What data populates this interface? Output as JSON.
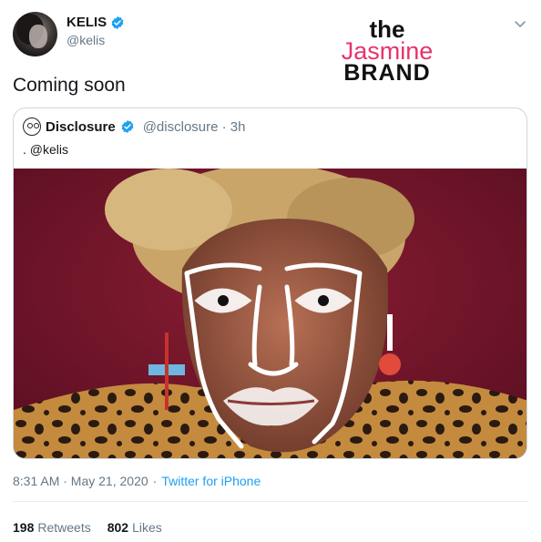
{
  "tweet": {
    "author": {
      "name": "KELIS",
      "handle": "@kelis",
      "verified": true
    },
    "text": "Coming soon",
    "timestamp": "8:31 AM · May 21, 2020",
    "separator": "·",
    "source": "Twitter for iPhone",
    "stats": {
      "retweets_count": "198",
      "retweets_label": "Retweets",
      "likes_count": "802",
      "likes_label": "Likes"
    }
  },
  "quoted_tweet": {
    "author": {
      "name": "Disclosure",
      "handle": "@disclosure · 3h",
      "verified": true
    },
    "text": ". @kelis"
  },
  "watermark": {
    "line1": "the",
    "line2": "Jasmine",
    "line3": "BRAND"
  },
  "icons": {
    "verified": "verified-badge-icon",
    "menu": "chevron-down-icon"
  },
  "colors": {
    "verified_blue": "#1da1f2",
    "link_blue": "#1da1f2",
    "secondary_text": "#657786",
    "logo_pink": "#e7336b"
  }
}
